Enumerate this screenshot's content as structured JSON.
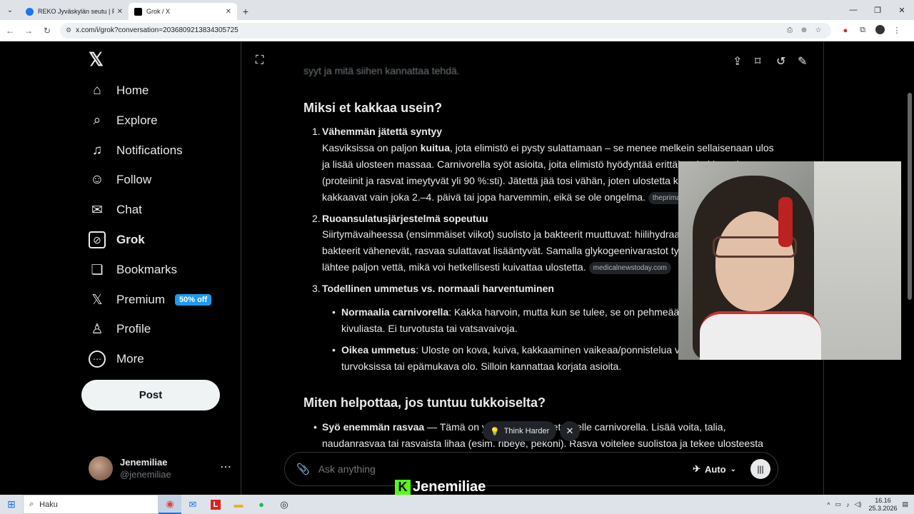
{
  "browser": {
    "tabs": [
      {
        "title": "REKO Jyväskylän seutu | Facebo",
        "active": false,
        "favicon_color": "#1877f2"
      },
      {
        "title": "Grok / X",
        "active": true,
        "favicon_color": "#000000"
      }
    ],
    "url": "x.com/i/grok?conversation=2036809213834305725"
  },
  "nav": {
    "items": [
      {
        "label": "Home",
        "icon": "home-icon",
        "glyph": "⌂"
      },
      {
        "label": "Explore",
        "icon": "search-icon",
        "glyph": "⌕"
      },
      {
        "label": "Notifications",
        "icon": "bell-icon",
        "glyph": "🔔"
      },
      {
        "label": "Follow",
        "icon": "follow-icon",
        "glyph": "👤"
      },
      {
        "label": "Chat",
        "icon": "mail-icon",
        "glyph": "✉"
      },
      {
        "label": "Grok",
        "icon": "grok-icon",
        "glyph": "⊘"
      },
      {
        "label": "Bookmarks",
        "icon": "bookmark-icon",
        "glyph": "🔖"
      },
      {
        "label": "Premium",
        "icon": "x-premium-icon",
        "glyph": "𝕏",
        "badge": "50% off"
      },
      {
        "label": "Profile",
        "icon": "profile-icon",
        "glyph": "👤"
      },
      {
        "label": "More",
        "icon": "more-icon",
        "glyph": "⋯"
      }
    ],
    "post_label": "Post",
    "account": {
      "name": "Jenemiliae",
      "handle": "@jenemiliae"
    }
  },
  "content": {
    "partial_top": "syyt ja mitä siihen kannattaa tehdä.",
    "heading1": "Miksi et kakkaa usein?",
    "items": [
      {
        "num": "1.",
        "title": "Vähemmän jätettä syntyy",
        "lines": [
          [
            "Kasviksissa on paljon ",
            "kuitua",
            ", jota elimistö ei pysty sulattamaan – se menee melkein sellaisenaan ulos"
          ],
          [
            "ja lisää ulosteen massaa. Carnivorella syöt asioita, joita elimistö hyödyntää erittäin tehokkaasti"
          ],
          [
            "(proteiinit ja rasvat imeytyvät yli 90 %:sti). Jätettä jää tosi vähän, joten ulostetta kertyy"
          ],
          [
            "kakkaavat vain joka 2.–4. päivä tai jopa harvemmin, eikä se ole ongelma."
          ]
        ],
        "source": "theprimal.com"
      },
      {
        "num": "2.",
        "title": "Ruoansulatusjärjestelmä sopeutuu",
        "lines": [
          [
            "Siirtymävaiheessa (ensimmäiset viikot) suolisto ja bakteerit muuttuvat: hiilihydraatteja"
          ],
          [
            "bakteerit vähenevät, rasvaa sulattavat lisääntyvät. Samalla glykogeenivarastot tyhjenevät"
          ],
          [
            "lähtee paljon vettä, mikä voi hetkellisesti kuivattaa ulostetta."
          ]
        ],
        "source": "medicalnewstoday.com"
      },
      {
        "num": "3.",
        "title": "Todellinen ummetus vs. normaali harventuminen"
      }
    ],
    "bullets": [
      {
        "bold": "Normaalia carnivorella",
        "line1": ": Kakka harvoin, mutta kun se tulee, se on pehmeää, helppoa ja",
        "line2": "kivuliasta. Ei turvotusta tai vatsavaivoja."
      },
      {
        "bold": "Oikea ummetus",
        "line1": ": Uloste on kova, kuiva, kakkaaminen vaikeaa/ponnistelua vaativaa,",
        "line2": "turvoksissa tai epämukava olo. Silloin kannattaa korjata asioita."
      }
    ],
    "heading2": "Miten helpottaa, jos tuntuu tukkoiselta?",
    "bullet3_bold": "Syö enemmän rasvaa",
    "bullet3_line1": " — Tämä on yleisin syy ummetukselle carnivorella. Lisää voita, talia,",
    "bullet3_line2": "naudanrasvaa tai rasvaista lihaa (esim. ribeye, pekoni). Rasva voitelee suolistoa ja tekee ulosteesta"
  },
  "composer": {
    "think_harder": "Think Harder",
    "placeholder": "Ask anything",
    "mode": "Auto"
  },
  "overlay": {
    "streamer": "Jenemiliae"
  },
  "taskbar": {
    "search": "Haku",
    "time": "16.16",
    "date": "25.3.2026"
  }
}
